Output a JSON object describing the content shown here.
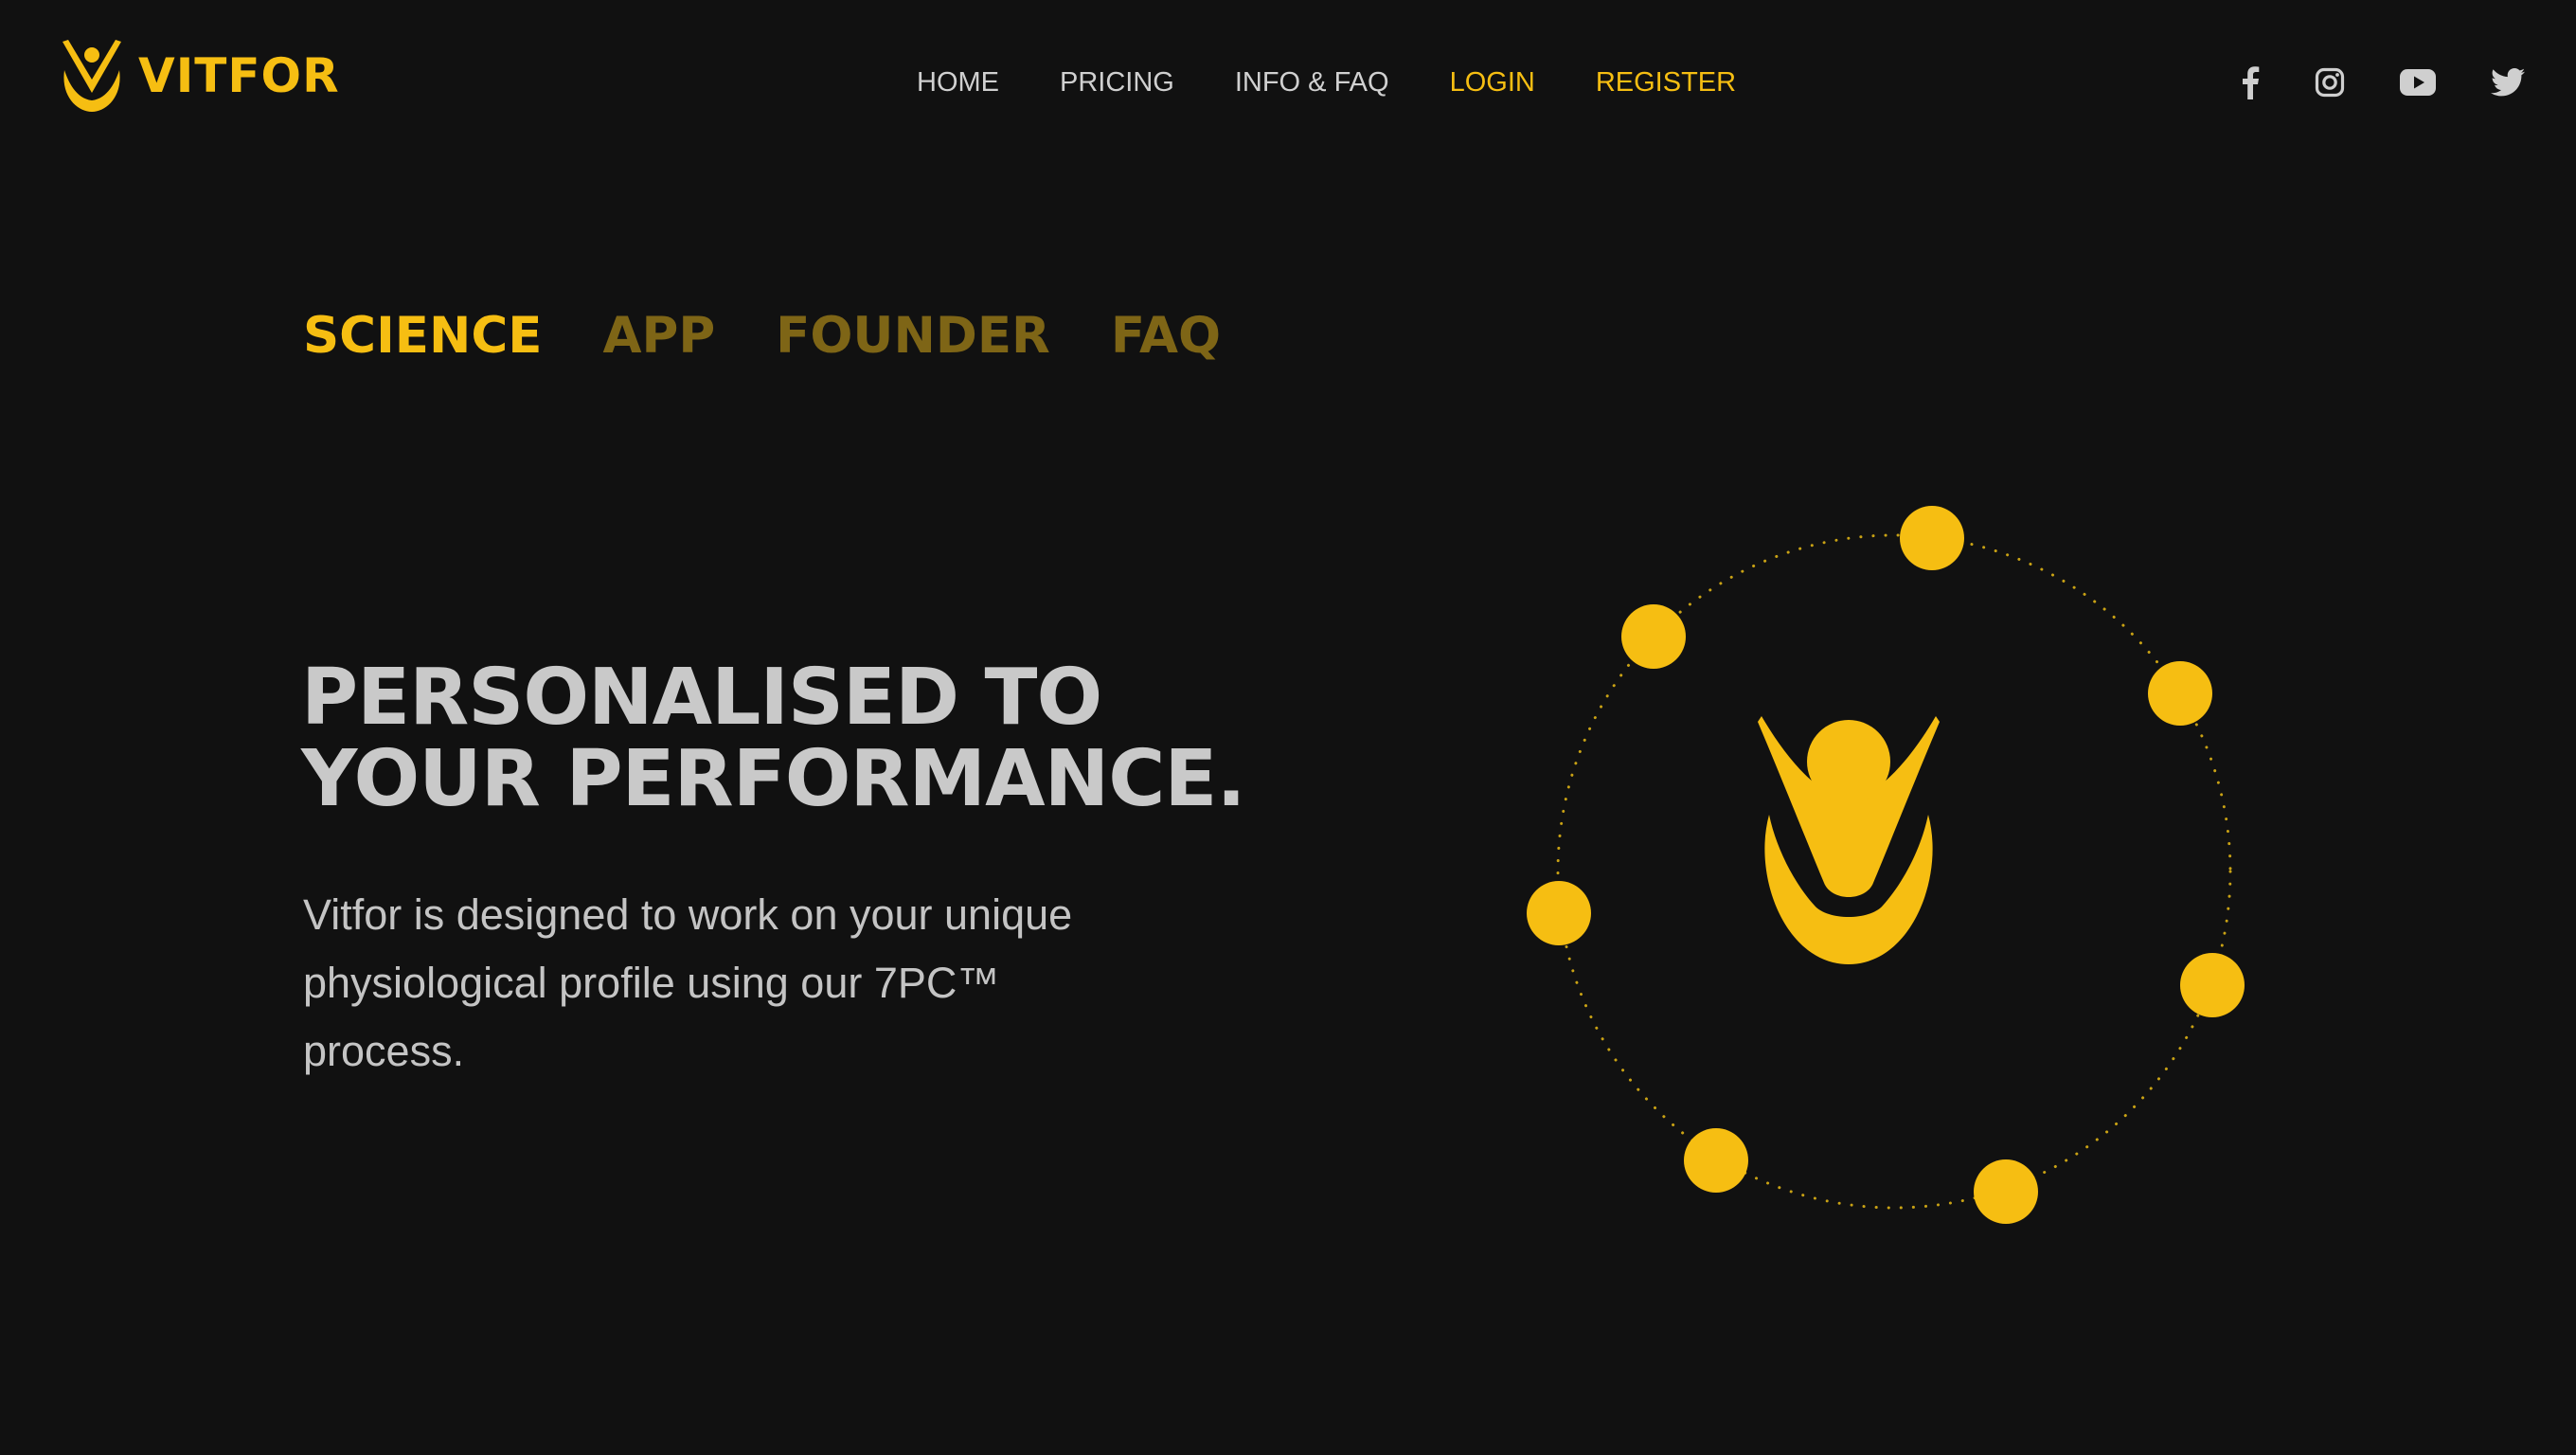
{
  "brand": {
    "name": "VITFOR",
    "accent_color": "#F6BE12",
    "background_color": "#111111",
    "logo_icon": "vitfor-person-v-icon"
  },
  "header": {
    "nav": [
      {
        "label": "HOME",
        "color": "#D0D0D0"
      },
      {
        "label": "PRICING",
        "color": "#D0D0D0"
      },
      {
        "label": "INFO & FAQ",
        "color": "#D0D0D0"
      },
      {
        "label": "LOGIN",
        "color": "#F6BE12"
      },
      {
        "label": "REGISTER",
        "color": "#F6BE12"
      }
    ],
    "social": [
      {
        "icon": "facebook-icon"
      },
      {
        "icon": "instagram-icon"
      },
      {
        "icon": "youtube-icon"
      },
      {
        "icon": "twitter-icon"
      }
    ]
  },
  "subnav": {
    "active": "SCIENCE",
    "items": [
      {
        "label": "SCIENCE"
      },
      {
        "label": "APP"
      },
      {
        "label": "FOUNDER"
      },
      {
        "label": "FAQ"
      }
    ]
  },
  "hero": {
    "title_line1": "PERSONALISED TO",
    "title_line2": "YOUR PERFORMANCE.",
    "description": "Vitfor is designed to work on your unique physiological profile using our 7PC™ process."
  },
  "illustration": {
    "name": "7pc-orbit-illustration",
    "center_icon": "vitfor-person-v-icon",
    "orbit_dot_count": 7
  }
}
